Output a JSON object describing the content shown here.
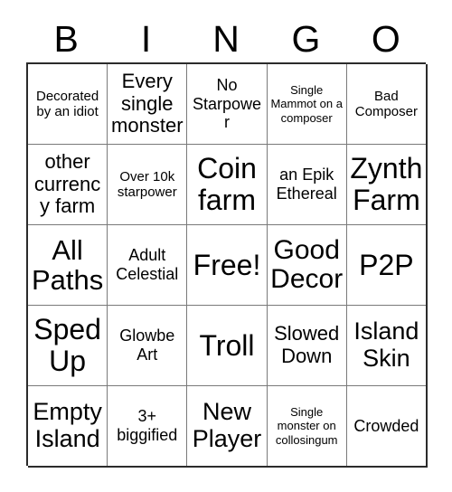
{
  "card": {
    "title": "BINGO",
    "header_letters": [
      "B",
      "I",
      "N",
      "G",
      "O"
    ],
    "grid_size": "5x5",
    "free_space": "Free!",
    "border_color": "#2b2b2b",
    "grid_line_color": "#7a7a7a",
    "background_color": "#ffffff",
    "text_color": "#000000",
    "cells": [
      {
        "text": "Decorated by an idiot",
        "size": "sm"
      },
      {
        "text": "Every single monster",
        "size": "lg"
      },
      {
        "text": "No Starpower",
        "size": "md"
      },
      {
        "text": "Single Mammot on a composer",
        "size": "xs"
      },
      {
        "text": "Bad Composer",
        "size": "sm"
      },
      {
        "text": "other currency farm",
        "size": "lg"
      },
      {
        "text": "Over 10k starpower",
        "size": "sm"
      },
      {
        "text": "Coin farm",
        "size": "xxl"
      },
      {
        "text": "an Epik Ethereal",
        "size": "md"
      },
      {
        "text": "Zynth Farm",
        "size": "xxl"
      },
      {
        "text": "All Paths",
        "size": "xxl"
      },
      {
        "text": "Adult Celestial",
        "size": "md"
      },
      {
        "text": "Free!",
        "size": "xxl"
      },
      {
        "text": "Good Decor",
        "size": "xxl"
      },
      {
        "text": "P2P",
        "size": "xxl"
      },
      {
        "text": "Sped Up",
        "size": "xxl"
      },
      {
        "text": "Glowbe Art",
        "size": "md"
      },
      {
        "text": "Troll",
        "size": "xxl"
      },
      {
        "text": "Slowed Down",
        "size": "lg"
      },
      {
        "text": "Island Skin",
        "size": "xl"
      },
      {
        "text": "Empty Island",
        "size": "xl"
      },
      {
        "text": "3+ biggified",
        "size": "md"
      },
      {
        "text": "New Player",
        "size": "xl"
      },
      {
        "text": "Single monster on collosingum",
        "size": "xs"
      },
      {
        "text": "Crowded",
        "size": "md"
      }
    ]
  }
}
